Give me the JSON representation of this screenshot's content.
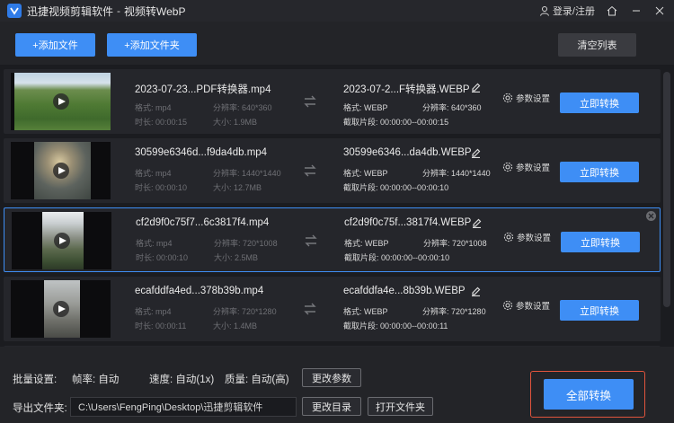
{
  "app": {
    "name": "迅捷视频剪辑软件",
    "separator": "-",
    "subtitle": "视频转WebP",
    "login": "登录/注册"
  },
  "toolbar": {
    "add_file": "+添加文件",
    "add_folder": "+添加文件夹",
    "clear_list": "清空列表"
  },
  "labels": {
    "format": "格式:",
    "resolution": "分辨率:",
    "duration": "时长:",
    "size": "大小:",
    "clip": "截取片段:",
    "params": "参数设置",
    "convert": "立即转换"
  },
  "files": [
    {
      "src_name": "2023-07-23...PDF转换器.mp4",
      "src_format": "mp4",
      "src_resolution": "640*360",
      "src_duration": "00:00:15",
      "src_size": "1.9MB",
      "out_name": "2023-07-2...F转换器.WEBP",
      "out_format": "WEBP",
      "out_resolution": "640*360",
      "clip": "00:00:00--00:00:15",
      "selected": false
    },
    {
      "src_name": "30599e6346d...f9da4db.mp4",
      "src_format": "mp4",
      "src_resolution": "1440*1440",
      "src_duration": "00:00:10",
      "src_size": "12.7MB",
      "out_name": "30599e6346...da4db.WEBP",
      "out_format": "WEBP",
      "out_resolution": "1440*1440",
      "clip": "00:00:00--00:00:10",
      "selected": false
    },
    {
      "src_name": "cf2d9f0c75f7...6c3817f4.mp4",
      "src_format": "mp4",
      "src_resolution": "720*1008",
      "src_duration": "00:00:10",
      "src_size": "2.5MB",
      "out_name": "cf2d9f0c75f...3817f4.WEBP",
      "out_format": "WEBP",
      "out_resolution": "720*1008",
      "clip": "00:00:00--00:00:10",
      "selected": true
    },
    {
      "src_name": "ecafddfa4ed...378b39b.mp4",
      "src_format": "mp4",
      "src_resolution": "720*1280",
      "src_duration": "00:00:11",
      "src_size": "1.4MB",
      "out_name": "ecafddfa4e...8b39b.WEBP",
      "out_format": "WEBP",
      "out_resolution": "720*1280",
      "clip": "00:00:00--00:00:11",
      "selected": false
    }
  ],
  "batch": {
    "label": "批量设置:",
    "fps": "帧率: 自动",
    "speed": "速度: 自动(1x)",
    "quality": "质量: 自动(高)",
    "change_params": "更改参数"
  },
  "export": {
    "label": "导出文件夹:",
    "path": "C:\\Users\\FengPing\\Desktop\\迅捷剪辑软件",
    "change_dir": "更改目录",
    "open_folder": "打开文件夹"
  },
  "convert_all": "全部转换",
  "colors": {
    "accent": "#3e8ef5",
    "highlight_border": "#e0543c"
  }
}
